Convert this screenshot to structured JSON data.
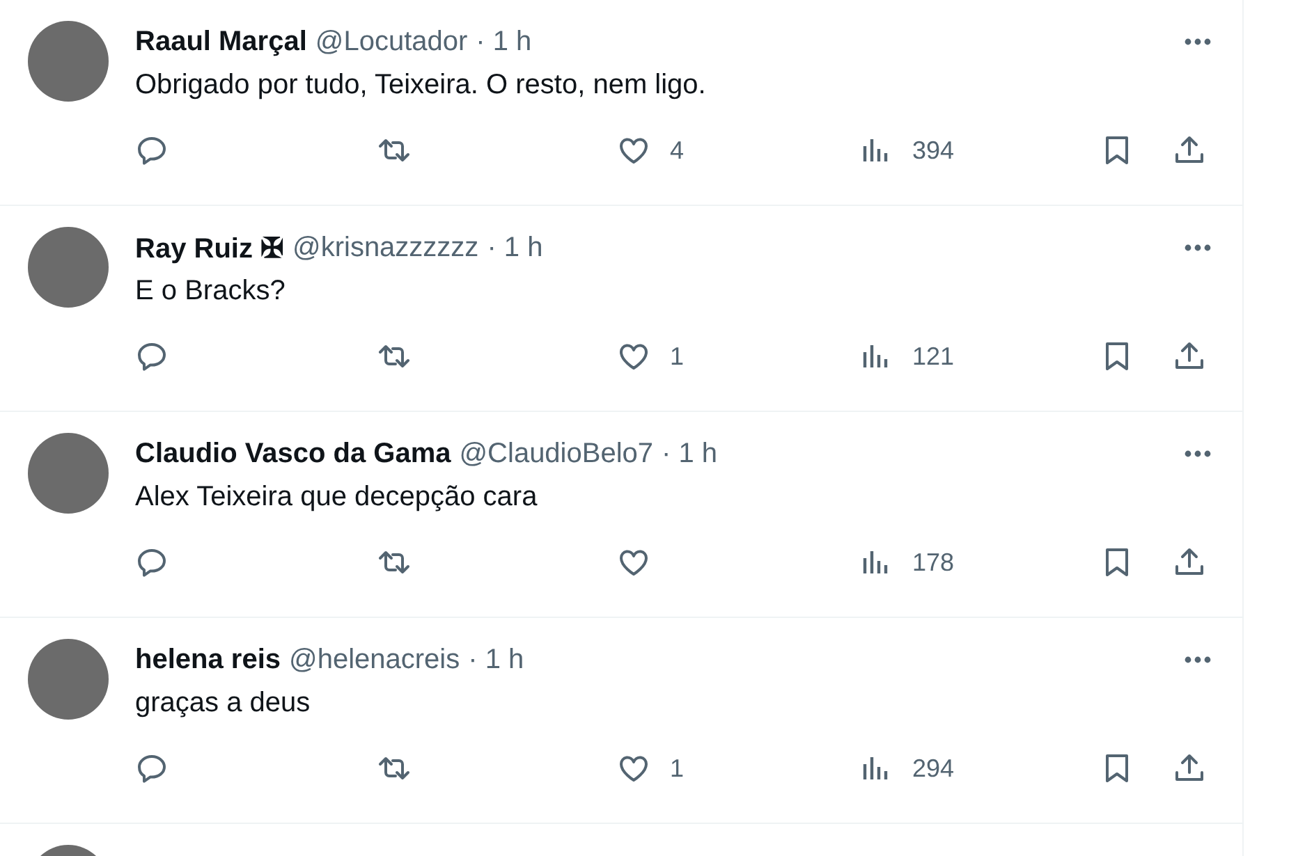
{
  "tweets": [
    {
      "name": "Raaul Marçal",
      "handle": "@Locutador",
      "time": "· 1 h",
      "text": "Obrigado por tudo, Teixeira. O resto, nem ligo.",
      "likes": "4",
      "views": "394"
    },
    {
      "name": "Ray Ruiz ✠",
      "handle": "@krisnazzzzzz",
      "time": "· 1 h",
      "text": "E o Bracks?",
      "likes": "1",
      "views": "121"
    },
    {
      "name": "Claudio Vasco da Gama",
      "handle": "@ClaudioBelo7",
      "time": "· 1 h",
      "text": "Alex Teixeira que decepção cara",
      "views": "178"
    },
    {
      "name": "helena reis",
      "handle": "@helenacreis",
      "time": "· 1 h",
      "text": "graças a deus",
      "likes": "1",
      "views": "294"
    }
  ]
}
